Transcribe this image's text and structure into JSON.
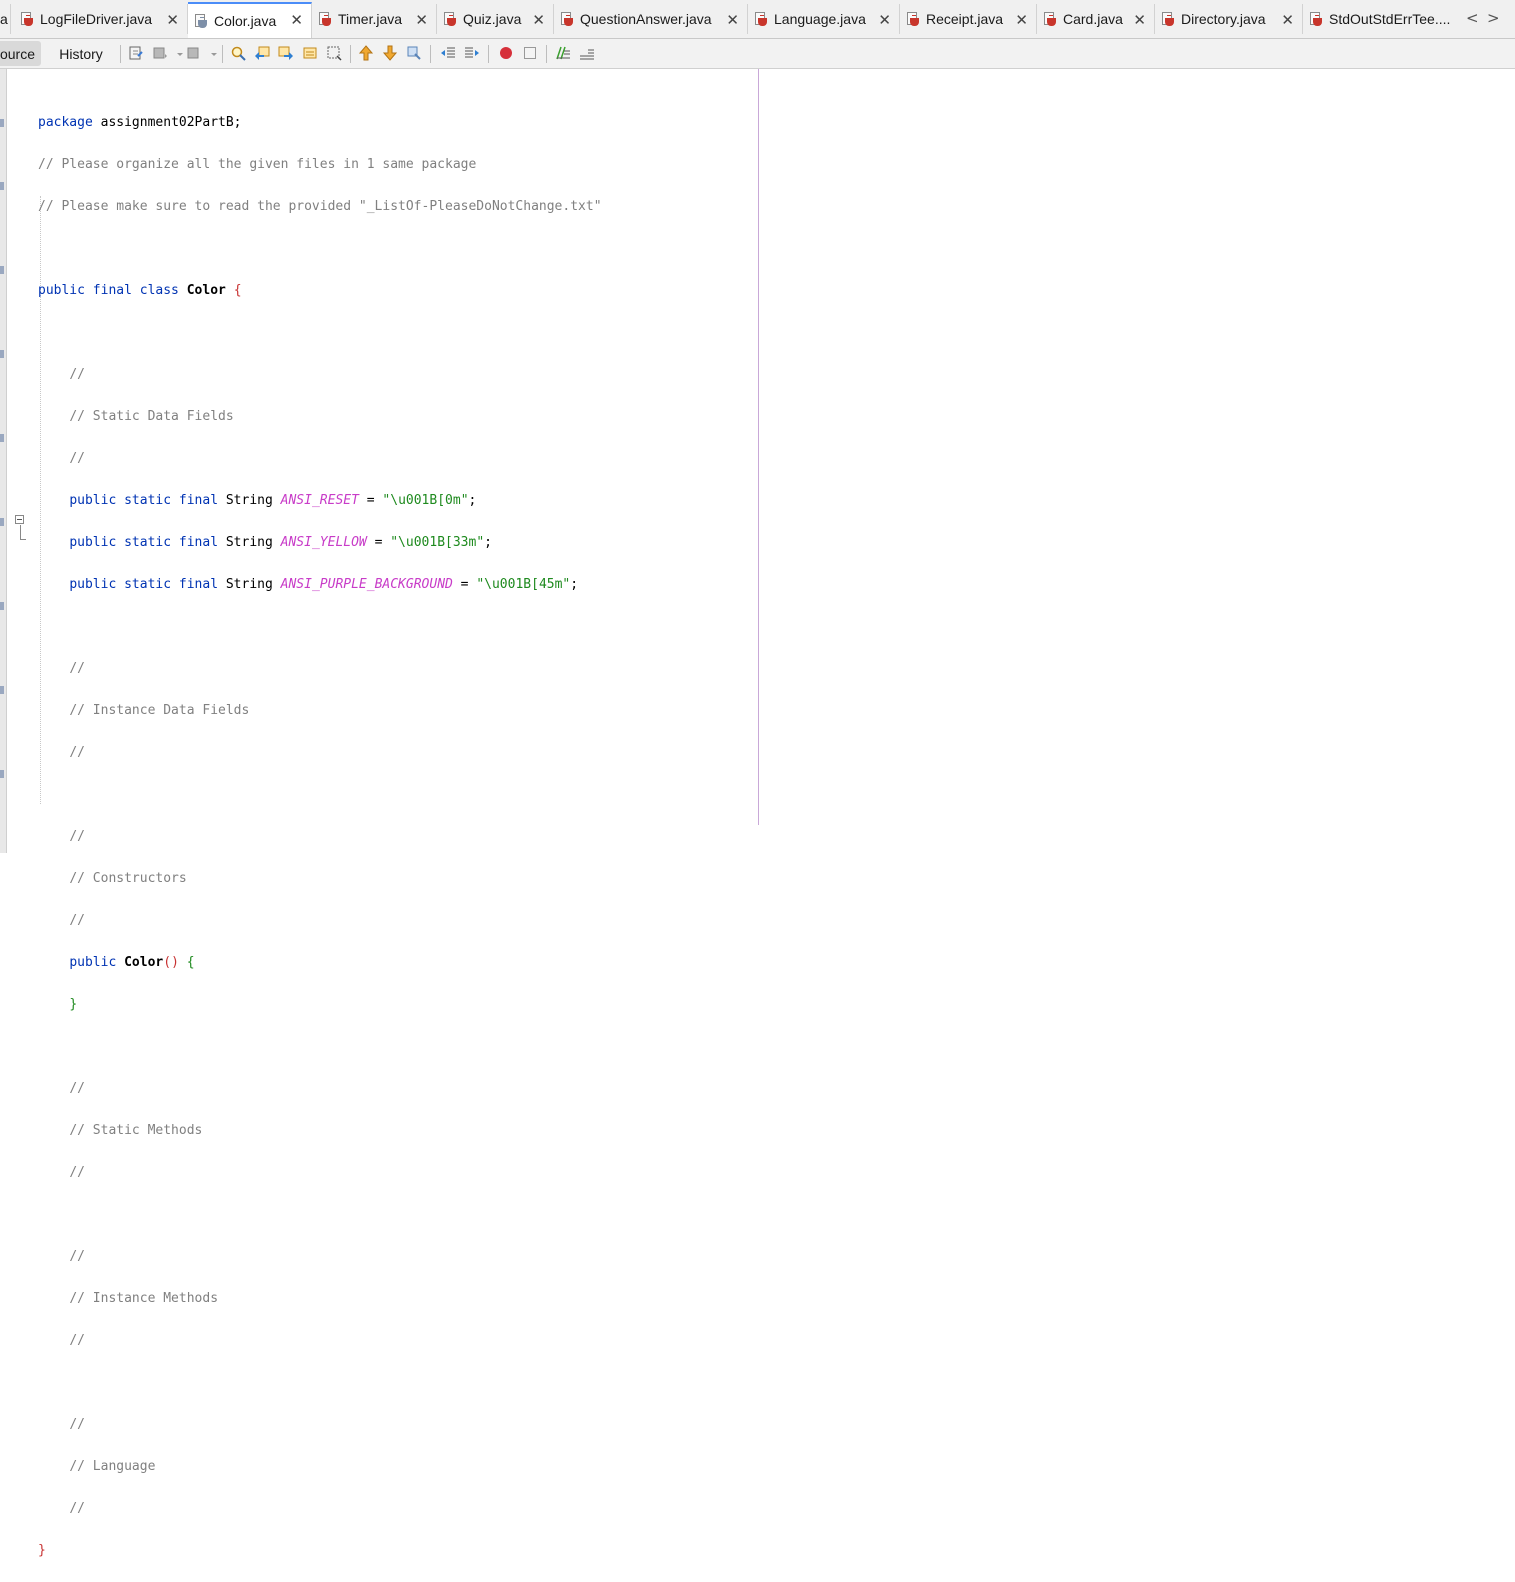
{
  "tabs": [
    {
      "label": "a",
      "active": false,
      "partial": true
    },
    {
      "label": "LogFileDriver.java",
      "active": false
    },
    {
      "label": "Color.java",
      "active": true
    },
    {
      "label": "Timer.java",
      "active": false
    },
    {
      "label": "Quiz.java",
      "active": false
    },
    {
      "label": "QuestionAnswer.java",
      "active": false
    },
    {
      "label": "Language.java",
      "active": false
    },
    {
      "label": "Receipt.java",
      "active": false
    },
    {
      "label": "Card.java",
      "active": false
    },
    {
      "label": "Directory.java",
      "active": false
    },
    {
      "label": "StdOutStdErrTee....",
      "active": false
    }
  ],
  "tab_close_glyph": "✕",
  "nav": {
    "prev": "<",
    "next": ">"
  },
  "toolbar": {
    "source_label": "Source",
    "history_label": "History",
    "icons": [
      "last-edit-icon",
      "back-icon",
      "forward-icon",
      "find-selection-icon",
      "find-previous-icon",
      "find-next-icon",
      "toggle-highlight-icon",
      "toggle-rect-select-icon",
      "previous-bookmark-icon",
      "next-bookmark-icon",
      "toggle-bookmark-icon",
      "shift-left-icon",
      "shift-right-icon",
      "start-macro-icon",
      "stop-macro-icon",
      "comment-icon",
      "uncomment-icon"
    ]
  },
  "code": {
    "package_kw": "package",
    "package_name": "assignment02PartB;",
    "comment1": "// Please organize all the given files in 1 same package",
    "comment2": "// Please make sure to read the provided \"_ListOf-PleaseDoNotChange.txt\"",
    "class_decl": {
      "mods": "public final class",
      "name": "Color",
      "open": "{"
    },
    "slashes": "//",
    "section_static_fields": "// Static Data Fields",
    "field_mods": "public static final",
    "field_type": "String",
    "fields": [
      {
        "name": "ANSI_RESET",
        "eq": "=",
        "value": "\"\\u001B[0m\"",
        "semi": ";"
      },
      {
        "name": "ANSI_YELLOW",
        "eq": "=",
        "value": "\"\\u001B[33m\"",
        "semi": ";"
      },
      {
        "name": "ANSI_PURPLE_BACKGROUND",
        "eq": "=",
        "value": "\"\\u001B[45m\"",
        "semi": ";"
      }
    ],
    "section_instance_fields": "// Instance Data Fields",
    "section_constructors": "// Constructors",
    "ctor": {
      "kw": "public",
      "name": "Color",
      "parens": "()",
      "open": "{",
      "close": "}"
    },
    "section_static_methods": "// Static Methods",
    "section_instance_methods": "// Instance Methods",
    "section_language": "// Language",
    "class_close": "}"
  },
  "colors": {
    "keyword": "#0033b3",
    "comment": "#808080",
    "string": "#1e8a1e",
    "field": "#c83cc8",
    "brace": "#c83232",
    "active_tab_accent": "#4b8df8"
  }
}
